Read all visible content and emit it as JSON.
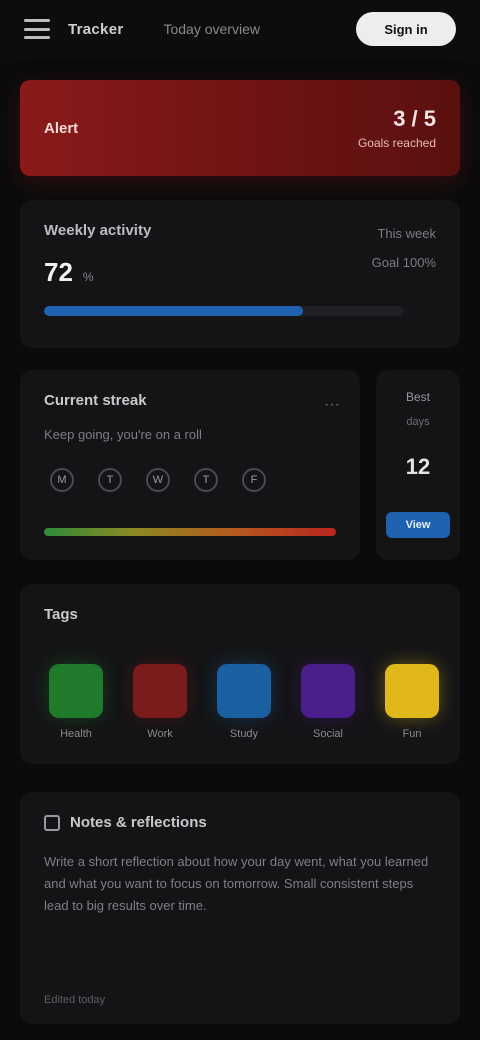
{
  "topbar": {
    "menu_icon": "menu-icon",
    "title": "Tracker",
    "subtitle": "Today overview",
    "action_label": "Sign in"
  },
  "banner": {
    "text": "Alert",
    "value": "3 / 5",
    "caption": "Goals reached",
    "color": "#8b1a1a"
  },
  "stats": {
    "label": "Weekly activity",
    "right_top": "This week",
    "right_bottom": "Goal 100%",
    "value": "72",
    "unit": "%",
    "progress": 0.72,
    "progress_color": "#1f63b0"
  },
  "streak": {
    "title": "Current streak",
    "menu": "···",
    "subtitle": "Keep going, you're on a roll",
    "days": [
      "M",
      "T",
      "W",
      "T",
      "F"
    ]
  },
  "side": {
    "label": "Best",
    "sub": "days",
    "value": "12",
    "button": "View"
  },
  "categories": {
    "title": "Tags",
    "items": [
      {
        "label": "Health",
        "color": "#1f7a2c"
      },
      {
        "label": "Work",
        "color": "#7a1c1c"
      },
      {
        "label": "Study",
        "color": "#1a5fa0"
      },
      {
        "label": "Social",
        "color": "#4a1f8c"
      },
      {
        "label": "Fun",
        "color": "#e0b81a"
      }
    ]
  },
  "notes": {
    "icon": "note-icon",
    "title": "Notes & reflections",
    "body": "Write a short reflection about how your day went, what you learned and what you want to focus on tomorrow. Small consistent steps lead to big results over time.",
    "footer": "Edited today"
  }
}
